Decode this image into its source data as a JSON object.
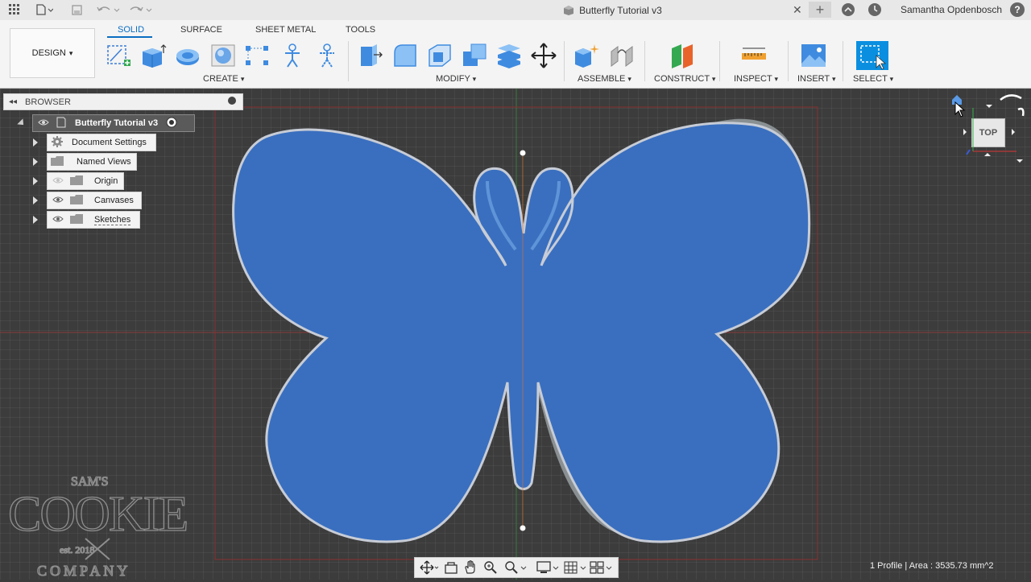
{
  "titlebar": {
    "document_title": "Butterfly Tutorial v3",
    "user_name": "Samantha Opdenbosch",
    "close_glyph": "✕",
    "add_glyph": "+",
    "help_glyph": "?"
  },
  "ribbon": {
    "workspace_label": "DESIGN",
    "tabs": [
      {
        "label": "SOLID",
        "active": true
      },
      {
        "label": "SURFACE",
        "active": false
      },
      {
        "label": "SHEET METAL",
        "active": false
      },
      {
        "label": "TOOLS",
        "active": false
      }
    ],
    "groups": {
      "create": "CREATE",
      "modify": "MODIFY",
      "assemble": "ASSEMBLE",
      "construct": "CONSTRUCT",
      "inspect": "INSPECT",
      "insert": "INSERT",
      "select": "SELECT"
    },
    "dropdown_glyph": "▾"
  },
  "browser": {
    "title": "BROWSER",
    "root": "Butterfly Tutorial v3",
    "items": [
      {
        "label": "Document Settings",
        "icon": "gear-icon"
      },
      {
        "label": "Named Views",
        "icon": "folder-icon"
      },
      {
        "label": "Origin",
        "icon": "folder-icon"
      },
      {
        "label": "Canvases",
        "icon": "folder-icon"
      },
      {
        "label": "Sketches",
        "icon": "folder-icon"
      }
    ]
  },
  "viewcube": {
    "face": "TOP"
  },
  "status": {
    "profile_text": "1 Profile | Area : 3535.73 mm^2"
  },
  "watermark": {
    "line1": "SAM'S",
    "line2": "COOKIE",
    "line3": "est. 2018",
    "line4": "COMPANY"
  },
  "colors": {
    "body_blue": "#3a6fbf",
    "body_edge": "#c7ccd6",
    "accent": "#0a6dc2",
    "viewport_bg": "#3c3c3c"
  }
}
